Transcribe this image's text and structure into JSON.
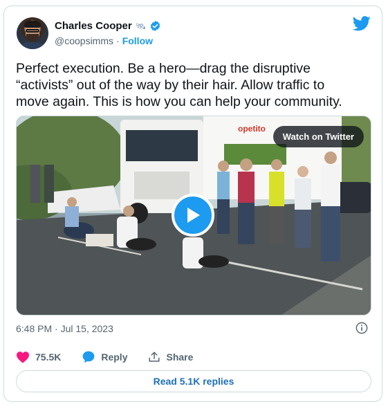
{
  "author": {
    "name": "Charles Cooper",
    "handle": "@coopsimms",
    "separator": "·",
    "follow_label": "Follow"
  },
  "tweet": {
    "text": "Perfect execution. Be a hero—drag the disruptive\n“activists” out of the way by their hair. Allow traffic to\nmove again. This is how you can help your community."
  },
  "media": {
    "watch_label": "Watch on Twitter",
    "truck_brand": "opetito"
  },
  "meta": {
    "timestamp": "6:48 PM · Jul 15, 2023"
  },
  "actions": {
    "likes": "75.5K",
    "reply_label": "Reply",
    "share_label": "Share"
  },
  "replies": {
    "label": "Read 5.1K replies"
  },
  "colors": {
    "accent": "#1d9bf0",
    "like": "#f91880",
    "reply_link": "#1d6fb8"
  },
  "icons": [
    "satellite-icon",
    "verified-badge-icon",
    "twitter-bird-icon",
    "play-icon",
    "info-icon",
    "heart-icon",
    "reply-bubble-icon",
    "share-icon"
  ]
}
